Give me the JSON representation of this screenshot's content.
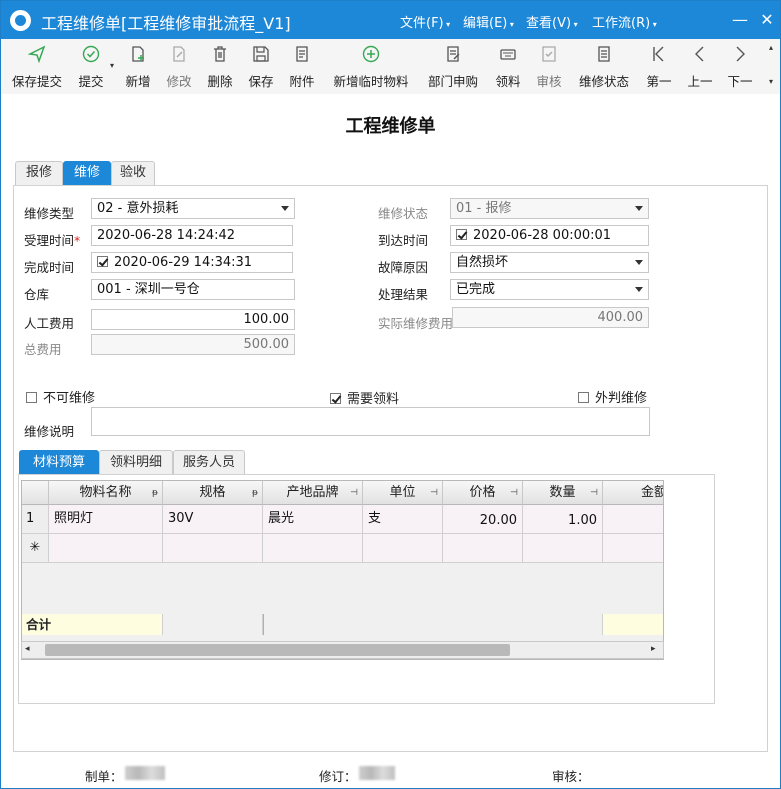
{
  "window": {
    "title": "工程维修单[工程维修审批流程_V1]",
    "menus": [
      "文件(F)",
      "编辑(E)",
      "查看(V)",
      "工作流(R)"
    ]
  },
  "toolbar": {
    "items": [
      {
        "label": "保存提交",
        "icon": "send-icon"
      },
      {
        "label": "提交",
        "icon": "check-circle-icon"
      },
      {
        "label": "新增",
        "icon": "new-doc-icon"
      },
      {
        "label": "修改",
        "icon": "edit-icon"
      },
      {
        "label": "删除",
        "icon": "trash-icon"
      },
      {
        "label": "保存",
        "icon": "save-icon"
      },
      {
        "label": "附件",
        "icon": "attachment-icon"
      },
      {
        "label": "新增临时物料",
        "icon": "plus-circle-icon"
      },
      {
        "label": "部门申购",
        "icon": "purchase-icon"
      },
      {
        "label": "领料",
        "icon": "keyboard-icon"
      },
      {
        "label": "审核",
        "icon": "approve-icon"
      },
      {
        "label": "维修状态",
        "icon": "status-icon"
      },
      {
        "label": "第一",
        "icon": "first-icon"
      },
      {
        "label": "上一",
        "icon": "prev-icon"
      },
      {
        "label": "下一",
        "icon": "next-icon"
      }
    ]
  },
  "page": {
    "title": "工程维修单"
  },
  "tabs": [
    "报修",
    "维修",
    "验收"
  ],
  "form": {
    "repair_type": {
      "label": "维修类型",
      "value": "02 - 意外损耗"
    },
    "accept_time": {
      "label": "受理时间",
      "value": "2020-06-28 14:24:42"
    },
    "finish_time": {
      "label": "完成时间",
      "value": "2020-06-29 14:34:31"
    },
    "warehouse": {
      "label": "仓库",
      "value": "001 - 深圳一号仓"
    },
    "labor_cost": {
      "label": "人工费用",
      "value": "100.00"
    },
    "total_cost": {
      "label": "总费用",
      "value": "500.00"
    },
    "repair_status": {
      "label": "维修状态",
      "value": "01 - 报修"
    },
    "arrive_time": {
      "label": "到达时间",
      "value": "2020-06-28 00:00:01"
    },
    "fault_reason": {
      "label": "故障原因",
      "value": "自然损坏"
    },
    "result": {
      "label": "处理结果",
      "value": "已完成"
    },
    "actual_cost": {
      "label": "实际维修费用",
      "value": "400.00"
    },
    "unrepairable": {
      "label": "不可维修"
    },
    "need_material": {
      "label": "需要领料"
    },
    "outsourced": {
      "label": "外判维修"
    },
    "description": {
      "label": "维修说明",
      "value": ""
    }
  },
  "subtabs": [
    "材料预算",
    "领料明细",
    "服务人员"
  ],
  "grid": {
    "columns": [
      "物料名称",
      "规格",
      "产地品牌",
      "单位",
      "价格",
      "数量",
      "金额"
    ],
    "rows": [
      {
        "no": "1",
        "cells": [
          "照明灯",
          "30V",
          "晨光",
          "支",
          "20.00",
          "1.00",
          ""
        ]
      }
    ],
    "new_row_marker": "✳",
    "sum_label": "合计"
  },
  "footer": {
    "maker": "制单：",
    "reviser": "修订：",
    "auditor": "审核："
  }
}
